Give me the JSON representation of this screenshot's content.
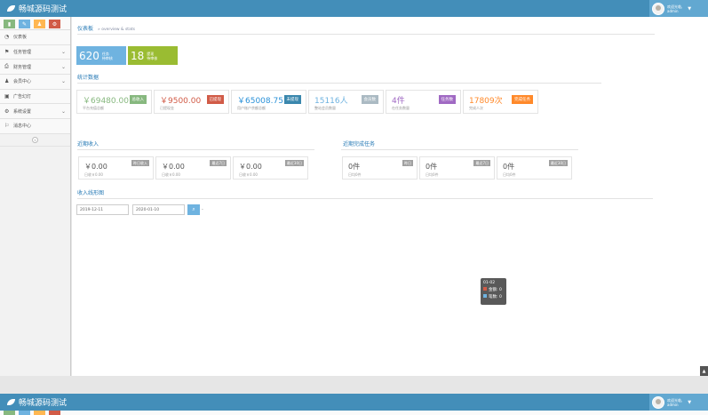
{
  "header": {
    "brand": "畅城源码测试",
    "welcome": "欢迎光临,",
    "username": "admin",
    "bg": "#438eb9"
  },
  "sidebar": {
    "shortcuts": [
      {
        "icon": "signal-icon",
        "glyph": "▮",
        "color": "#87b87f"
      },
      {
        "icon": "pencil-icon",
        "glyph": "✎",
        "color": "#6fb3e0"
      },
      {
        "icon": "users-icon",
        "glyph": "♟",
        "color": "#ffb752"
      },
      {
        "icon": "cogs-icon",
        "glyph": "⚙",
        "color": "#d15b47"
      }
    ],
    "items": [
      {
        "label": "仪表板",
        "icon": "dashboard-icon",
        "glyph": "◔",
        "has_sub": false
      },
      {
        "label": "任务管理",
        "icon": "flag-icon",
        "glyph": "⚑",
        "has_sub": true
      },
      {
        "label": "财务管理",
        "icon": "print-icon",
        "glyph": "⎙",
        "has_sub": true
      },
      {
        "label": "会员中心",
        "icon": "user-icon",
        "glyph": "♟",
        "has_sub": true
      },
      {
        "label": "广告幻灯",
        "icon": "picture-icon",
        "glyph": "▣",
        "has_sub": false
      },
      {
        "label": "系统设置",
        "icon": "cog-icon",
        "glyph": "⚙",
        "has_sub": true
      },
      {
        "label": "消息中心",
        "icon": "bookmark-icon",
        "glyph": "⚐",
        "has_sub": false
      }
    ]
  },
  "page": {
    "title": "仪表板",
    "subtitle": "» overview & stats"
  },
  "tiles": [
    {
      "num": "620",
      "label1": "任务",
      "label2": "待审核",
      "color": "#6fb3e0"
    },
    {
      "num": "18",
      "label1": "提现",
      "label2": "待审核",
      "color": "#9abc32"
    }
  ],
  "stats": {
    "heading": "统计数据",
    "items": [
      {
        "value": "￥69480.00",
        "label": "平台充值总额",
        "badge": "总收入",
        "color": "#87b87f",
        "badge_color": "#87b87f"
      },
      {
        "value": "￥9500.00",
        "label": "已提现金",
        "badge": "已提现",
        "color": "#d15b47",
        "badge_color": "#d15b47"
      },
      {
        "value": "￥65008.75",
        "label": "用户账户余额总额",
        "badge": "未提现",
        "color": "#2a91d8",
        "badge_color": "#3a87ad"
      },
      {
        "value": "15116人",
        "label": "整站会员数量",
        "badge": "会员数",
        "color": "#6fb3e0",
        "badge_color": "#abbac3"
      },
      {
        "value": "4件",
        "label": "在任务数量",
        "badge": "任务数",
        "color": "#a069c3",
        "badge_color": "#a069c3"
      },
      {
        "value": "17809次",
        "label": "完成人次",
        "badge": "完成任务",
        "color": "#ff892a",
        "badge_color": "#ff892a"
      }
    ]
  },
  "income": {
    "heading": "近期收入",
    "items": [
      {
        "value": "￥0.00",
        "label": "日收￥0.00",
        "badge": "昨日收入"
      },
      {
        "value": "￥0.00",
        "label": "日收￥0.00",
        "badge": "最近7日"
      },
      {
        "value": "￥0.00",
        "label": "日收￥0.00",
        "badge": "最近30日"
      }
    ]
  },
  "tasks": {
    "heading": "近期完成任务",
    "items": [
      {
        "value": "0件",
        "label": "日均0件",
        "badge": "昨日"
      },
      {
        "value": "0件",
        "label": "日均0件",
        "badge": "最近7日"
      },
      {
        "value": "0件",
        "label": "日均0件",
        "badge": "最近30日"
      }
    ]
  },
  "trend": {
    "heading": "收入线形图",
    "start_date": "2019-12-11",
    "end_date": "2020-01-10",
    "separator": "-",
    "search_icon": "search-icon",
    "tooltip": {
      "date": "01-02",
      "row1": "金额: 0",
      "row2": "笔数: 0",
      "color1": "#d15b47",
      "color2": "#6fb3e0"
    }
  }
}
